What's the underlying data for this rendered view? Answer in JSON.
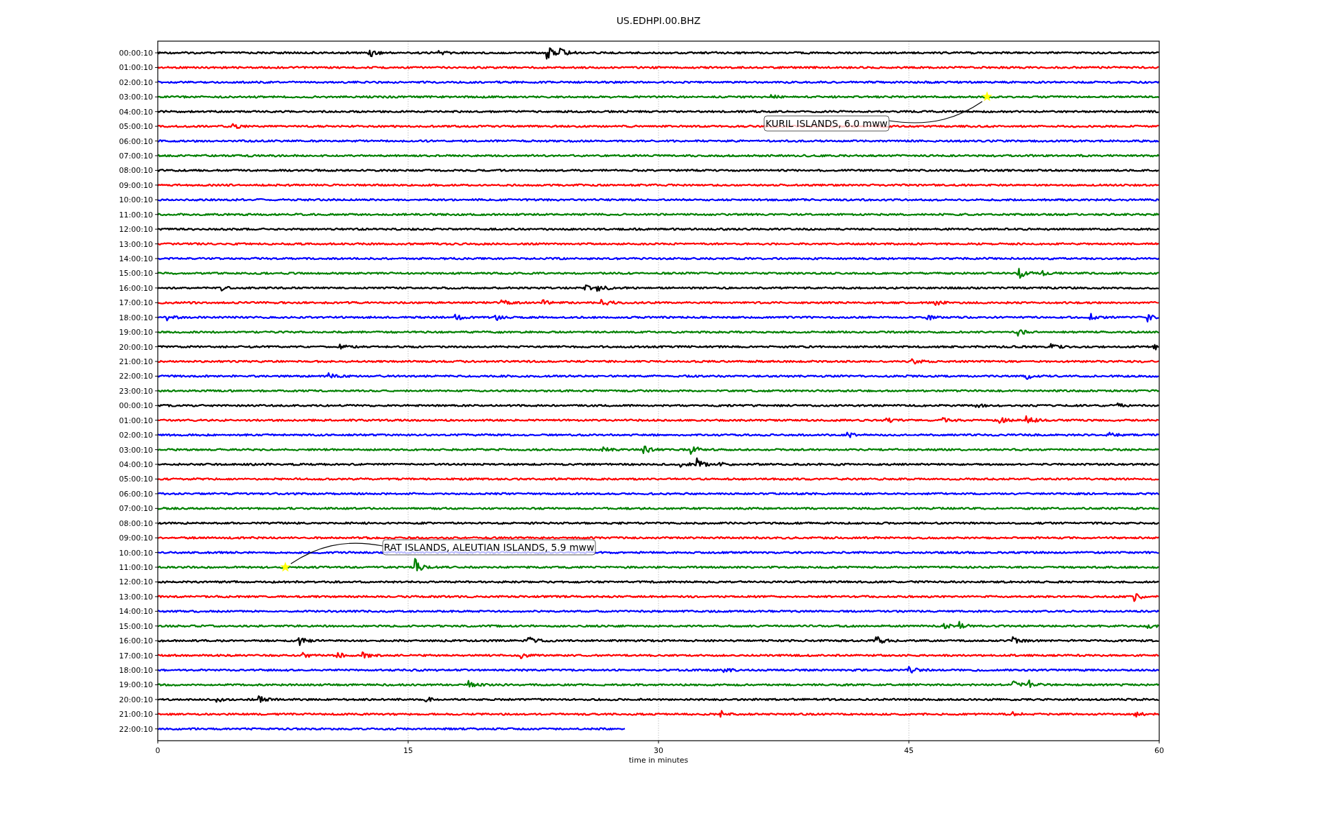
{
  "title": "US.EDHPI.00.BHZ",
  "plot": {
    "traces": [
      {
        "label": "00:00:10",
        "color": "#000000",
        "level": 1
      },
      {
        "label": "01:00:10",
        "color": "#ff0000",
        "level": 1
      },
      {
        "label": "02:00:10",
        "color": "#0000ff",
        "level": 1
      },
      {
        "label": "03:00:10",
        "color": "#008000",
        "level": 1
      },
      {
        "label": "04:00:10",
        "color": "#000000",
        "level": 1
      },
      {
        "label": "05:00:10",
        "color": "#ff0000",
        "level": 1
      },
      {
        "label": "06:00:10",
        "color": "#0000ff",
        "level": 1
      },
      {
        "label": "07:00:10",
        "color": "#008000",
        "level": 1
      },
      {
        "label": "08:00:10",
        "color": "#000000",
        "level": 1
      },
      {
        "label": "09:00:10",
        "color": "#ff0000",
        "level": 1
      },
      {
        "label": "10:00:10",
        "color": "#0000ff",
        "level": 1
      },
      {
        "label": "11:00:10",
        "color": "#008000",
        "level": 1
      },
      {
        "label": "12:00:10",
        "color": "#000000",
        "level": 1
      },
      {
        "label": "13:00:10",
        "color": "#ff0000",
        "level": 1
      },
      {
        "label": "14:00:10",
        "color": "#0000ff",
        "level": 1
      },
      {
        "label": "15:00:10",
        "color": "#008000",
        "level": 1
      },
      {
        "label": "16:00:10",
        "color": "#000000",
        "level": 1
      },
      {
        "label": "17:00:10",
        "color": "#ff0000",
        "level": 1
      },
      {
        "label": "18:00:10",
        "color": "#0000ff",
        "level": 1
      },
      {
        "label": "19:00:10",
        "color": "#008000",
        "level": 1
      },
      {
        "label": "20:00:10",
        "color": "#000000",
        "level": 1
      },
      {
        "label": "21:00:10",
        "color": "#ff0000",
        "level": 1
      },
      {
        "label": "22:00:10",
        "color": "#0000ff",
        "level": 1
      },
      {
        "label": "23:00:10",
        "color": "#008000",
        "level": 1
      },
      {
        "label": "00:00:10",
        "color": "#000000",
        "level": 1
      },
      {
        "label": "01:00:10",
        "color": "#ff0000",
        "level": 1
      },
      {
        "label": "02:00:10",
        "color": "#0000ff",
        "level": 1
      },
      {
        "label": "03:00:10",
        "color": "#008000",
        "level": 1
      },
      {
        "label": "04:00:10",
        "color": "#000000",
        "level": 1
      },
      {
        "label": "05:00:10",
        "color": "#ff0000",
        "level": 1
      },
      {
        "label": "06:00:10",
        "color": "#0000ff",
        "level": 1
      },
      {
        "label": "07:00:10",
        "color": "#008000",
        "level": 1
      },
      {
        "label": "08:00:10",
        "color": "#000000",
        "level": 1
      },
      {
        "label": "09:00:10",
        "color": "#ff0000",
        "level": 1
      },
      {
        "label": "10:00:10",
        "color": "#0000ff",
        "level": 1
      },
      {
        "label": "11:00:10",
        "color": "#008000",
        "level": 1
      },
      {
        "label": "12:00:10",
        "color": "#000000",
        "level": 1
      },
      {
        "label": "13:00:10",
        "color": "#ff0000",
        "level": 1
      },
      {
        "label": "14:00:10",
        "color": "#0000ff",
        "level": 1
      },
      {
        "label": "15:00:10",
        "color": "#008000",
        "level": 1
      },
      {
        "label": "16:00:10",
        "color": "#000000",
        "level": 1
      },
      {
        "label": "17:00:10",
        "color": "#ff0000",
        "level": 1
      },
      {
        "label": "18:00:10",
        "color": "#0000ff",
        "level": 1
      },
      {
        "label": "19:00:10",
        "color": "#008000",
        "level": 1
      },
      {
        "label": "20:00:10",
        "color": "#000000",
        "level": 1
      },
      {
        "label": "21:00:10",
        "color": "#ff0000",
        "level": 1
      },
      {
        "label": "22:00:10",
        "color": "#0000ff",
        "level": 0.467
      }
    ],
    "xticks": [
      "0",
      "15",
      "30",
      "45",
      "60"
    ],
    "xlabel": "time in minutes",
    "events": [
      {
        "label": "KURIL ISLANDS, 6.0 mww"
      },
      {
        "label": "RAT ISLANDS, ALEUTIAN ISLANDS, 5.9 mww"
      }
    ]
  }
}
